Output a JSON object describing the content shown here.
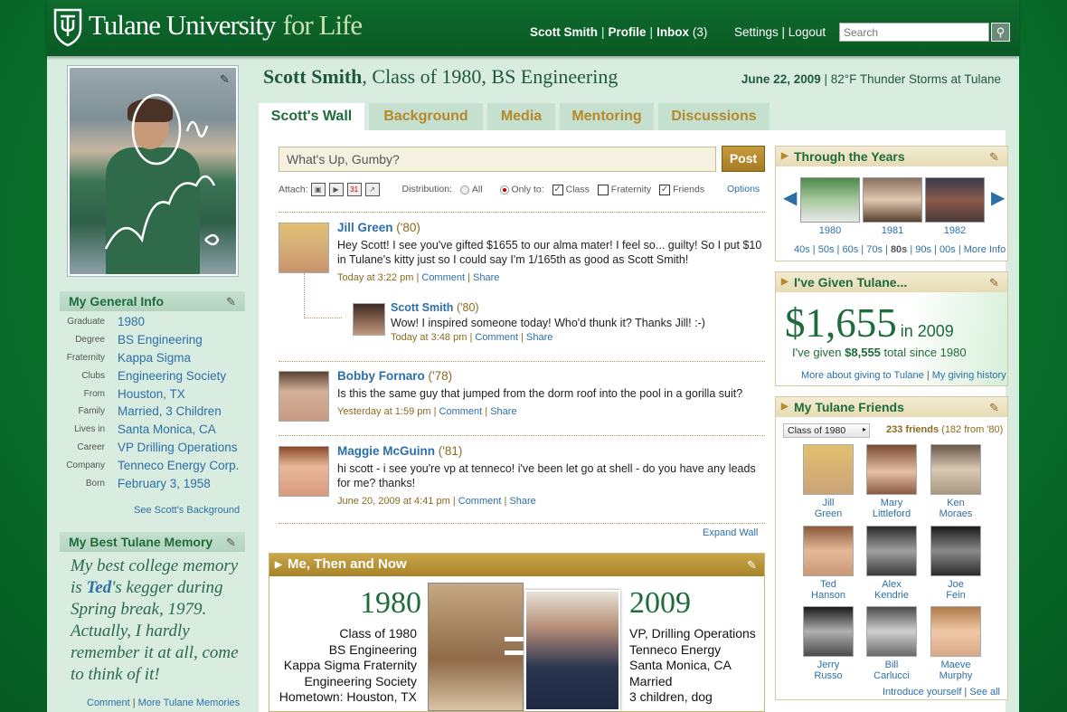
{
  "header": {
    "brand_main": "Tulane University",
    "brand_accent": "for Life",
    "user_name": "Scott Smith",
    "profile_label": "Profile",
    "inbox_label": "Inbox",
    "inbox_count": "(3)",
    "settings_label": "Settings",
    "logout_label": "Logout",
    "search_placeholder": "Search"
  },
  "profile": {
    "name": "Scott Smith",
    "subtitle": ", Class of 1980, BS Engineering",
    "date": "June 22, 2009",
    "weather": "82°F Thunder Storms at Tulane"
  },
  "general_info": {
    "title": "My General Info",
    "rows": [
      {
        "k": "Graduate",
        "v": "1980"
      },
      {
        "k": "Degree",
        "v": "BS Engineering"
      },
      {
        "k": "Fraternity",
        "v": "Kappa Sigma"
      },
      {
        "k": "Clubs",
        "v": "Engineering Society"
      },
      {
        "k": "From",
        "v": "Houston, TX"
      },
      {
        "k": "Family",
        "v": "Married, 3 Children"
      },
      {
        "k": "Lives in",
        "v": "Santa Monica, CA"
      },
      {
        "k": "Career",
        "v": "VP Drilling Operations"
      },
      {
        "k": "Company",
        "v": "Tenneco Energy Corp."
      },
      {
        "k": "Born",
        "v": "February 3, 1958"
      }
    ],
    "see_background": "See Scott's Background"
  },
  "memory": {
    "title": "My Best Tulane Memory",
    "text_before": "My best college memory is ",
    "highlight": "Ted",
    "text_after": "'s kegger during Spring break, 1979. Actually, I hardly remember it at all, come to think of it!",
    "comment": "Comment",
    "more": "More Tulane Memories"
  },
  "tabs": [
    "Scott's Wall",
    "Background",
    "Media",
    "Mentoring",
    "Discussions"
  ],
  "composer": {
    "placeholder": "What's Up, Gumby?",
    "post": "Post",
    "attach": "Attach:",
    "distribution": "Distribution:",
    "all": "All",
    "only_to": "Only to:",
    "class": "Class",
    "fraternity": "Fraternity",
    "friends": "Friends",
    "options": "Options"
  },
  "posts": [
    {
      "name": "Jill Green",
      "year": "('80)",
      "text": "Hey Scott! I see you've gifted $1655 to our alma mater! I feel so... guilty! So I put $10 in Tulane's kitty just so I could say I'm 1/165th as good as Scott Smith!",
      "time": "Today at 3:22 pm",
      "comment": "Comment",
      "share": "Share"
    },
    {
      "name": "Scott Smith",
      "year": "('80)",
      "text": "Wow! I inspired someone today! Who'd thunk it? Thanks Jill! :-)",
      "time": "Today at 3:48 pm",
      "comment": "Comment",
      "share": "Share"
    },
    {
      "name": "Bobby Fornaro",
      "year": "('78)",
      "text": "Is this the same guy that jumped from the dorm roof into the pool in a gorilla suit?",
      "time": "Yesterday at 1:59 pm",
      "comment": "Comment",
      "share": "Share"
    },
    {
      "name": "Maggie McGuinn",
      "year": "('81)",
      "text": "hi scott - i see you're vp at tenneco! i've been let go at shell - do you have any leads for me? thanks!",
      "time": "June 20, 2009 at 4:41 pm",
      "comment": "Comment",
      "share": "Share"
    }
  ],
  "expand_wall": "Expand Wall",
  "then_now": {
    "title": "Me, Then and Now",
    "then_year": "1980",
    "then_items": [
      "Class of 1980",
      "BS Engineering",
      "Kappa Sigma Fraternity",
      "Engineering Society",
      "Hometown: Houston, TX"
    ],
    "now_year": "2009",
    "now_items": [
      "VP, Drilling Operations",
      "Tenneco Energy",
      "Santa Monica, CA",
      "Married",
      "3 children, dog"
    ]
  },
  "years_box": {
    "title": "Through the Years",
    "years": [
      "1980",
      "1981",
      "1982"
    ],
    "decades": [
      "40s",
      "50s",
      "60s",
      "70s",
      "80s",
      "90s",
      "00s"
    ],
    "more": "More Info"
  },
  "giving": {
    "title": "I've Given Tulane...",
    "amount": "$1,655",
    "year": "in 2009",
    "total_prefix": "I've given ",
    "total": "$8,555",
    "total_suffix": " total since 1980",
    "more": "More about giving to Tulane",
    "history": "My giving history"
  },
  "friends_box": {
    "title": "My Tulane Friends",
    "class_select": "Class of 1980",
    "count": "233 friends",
    "count_sub": "(182 from '80)",
    "friends": [
      {
        "first": "Jill",
        "last": "Green"
      },
      {
        "first": "Mary",
        "last": "Littleford"
      },
      {
        "first": "Ken",
        "last": "Moraes"
      },
      {
        "first": "Ted",
        "last": "Hanson"
      },
      {
        "first": "Alex",
        "last": "Kendrie"
      },
      {
        "first": "Joe",
        "last": "Fein"
      },
      {
        "first": "Jerry",
        "last": "Russo"
      },
      {
        "first": "Bill",
        "last": "Carlucci"
      },
      {
        "first": "Maeve",
        "last": "Murphy"
      }
    ],
    "introduce": "Introduce yourself",
    "see_all": "See all"
  },
  "colors": {
    "brand_green": "#0a5a25",
    "link_blue": "#2c6fa8",
    "gold": "#b5892a"
  }
}
